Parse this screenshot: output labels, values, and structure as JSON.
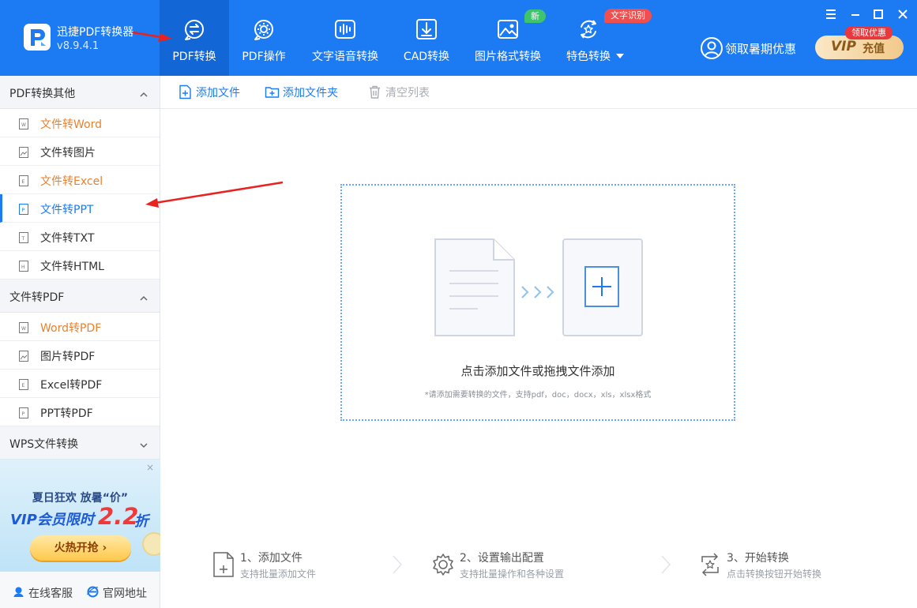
{
  "app": {
    "name": "迅捷PDF转换器",
    "version": "v8.9.4.1"
  },
  "nav": {
    "tabs": [
      {
        "label": "PDF转换",
        "icon": "pdf-convert-icon",
        "active": true
      },
      {
        "label": "PDF操作",
        "icon": "pdf-operate-icon",
        "active": false
      },
      {
        "label": "文字语音转换",
        "icon": "audio-wave-icon",
        "active": false
      },
      {
        "label": "CAD转换",
        "icon": "cad-icon",
        "active": false
      },
      {
        "label": "图片格式转换",
        "icon": "image-icon",
        "active": false
      },
      {
        "label": "特色转换",
        "icon": "star-cycle-icon",
        "active": false
      }
    ],
    "badge_new": "新",
    "badge_ocr": "文字识别"
  },
  "promo": {
    "summer_offer": "领取暑期优惠",
    "vip_tag": "领取优惠",
    "vip_word": "VIP",
    "vip_charge": "充值"
  },
  "sidebar": {
    "groups": [
      {
        "title": "PDF转换其他",
        "expanded": true,
        "items": [
          {
            "label": "文件转Word",
            "icon": "word-file-icon",
            "color": "orange"
          },
          {
            "label": "文件转图片",
            "icon": "image-file-icon",
            "color": "normal"
          },
          {
            "label": "文件转Excel",
            "icon": "excel-file-icon",
            "color": "orange"
          },
          {
            "label": "文件转PPT",
            "icon": "ppt-file-icon",
            "color": "blue",
            "active": true
          },
          {
            "label": "文件转TXT",
            "icon": "txt-file-icon",
            "color": "normal"
          },
          {
            "label": "文件转HTML",
            "icon": "html-file-icon",
            "color": "normal"
          }
        ]
      },
      {
        "title": "文件转PDF",
        "expanded": true,
        "items": [
          {
            "label": "Word转PDF",
            "icon": "word-file-icon",
            "color": "orange"
          },
          {
            "label": "图片转PDF",
            "icon": "image-file-icon",
            "color": "normal"
          },
          {
            "label": "Excel转PDF",
            "icon": "excel-file-icon",
            "color": "normal"
          },
          {
            "label": "PPT转PDF",
            "icon": "ppt-file-icon",
            "color": "normal"
          }
        ]
      },
      {
        "title": "WPS文件转换",
        "expanded": false,
        "items": []
      }
    ],
    "banner": {
      "close": "×",
      "line1": "夏日狂欢 放暑“价”",
      "line2": "VIP会员限时",
      "number": "2.2",
      "suffix": "折",
      "button": "火热开抢 ›"
    },
    "footer": {
      "service": "在线客服",
      "website": "官网地址"
    }
  },
  "toolbar": {
    "add_file": "添加文件",
    "add_folder": "添加文件夹",
    "clear_list": "清空列表"
  },
  "dropzone": {
    "title": "点击添加文件或拖拽文件添加",
    "hint": "*请添加需要转换的文件，支持pdf，doc，docx，xls，xlsx格式"
  },
  "steps": [
    {
      "title": "1、添加文件",
      "subtitle": "支持批量添加文件",
      "icon": "add-file-icon"
    },
    {
      "title": "2、设置输出配置",
      "subtitle": "支持批量操作和各种设置",
      "icon": "settings-gear-icon"
    },
    {
      "title": "3、开始转换",
      "subtitle": "点击转换按钮开始转换",
      "icon": "convert-star-icon"
    }
  ],
  "colors": {
    "header_blue": "#1c7bf2",
    "active_tab": "#1366d6",
    "accent_orange": "#e8822e",
    "annotation_red": "#e8231f"
  }
}
